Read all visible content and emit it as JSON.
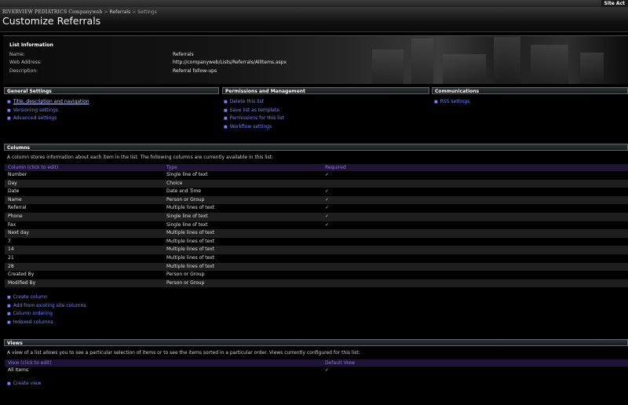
{
  "topbar": {
    "site_actions": "Site Act"
  },
  "breadcrumb": {
    "site": "RIVERVIEW PEDIATRICS Companyweb",
    "list": "Referrals",
    "current": "Settings",
    "sep": ">"
  },
  "page_title": "Customize Referrals",
  "list_info": {
    "heading": "List Information",
    "name_label": "Name:",
    "name_value": "Referrals",
    "web_label": "Web Address:",
    "web_value": "http://companyweb/Lists/Referrals/AllItems.aspx",
    "desc_label": "Description:",
    "desc_value": "Referral follow-ups"
  },
  "general_settings": {
    "title": "General Settings",
    "links": [
      "Title, description and navigation",
      "Versioning settings",
      "Advanced settings"
    ]
  },
  "permissions": {
    "title": "Permissions and Management",
    "links": [
      "Delete this list",
      "Save list as template",
      "Permissions for this list",
      "Workflow settings"
    ]
  },
  "communications": {
    "title": "Communications",
    "links": [
      "RSS settings"
    ]
  },
  "columns": {
    "title": "Columns",
    "description": "A column stores information about each item in the list. The following columns are currently available in this list:",
    "headers": [
      "Column (click to edit)",
      "Type",
      "Required"
    ],
    "check": "✓",
    "rows": [
      {
        "name": "Number",
        "type": "Single line of text",
        "req": "✓"
      },
      {
        "name": "Day",
        "type": "Choice",
        "req": ""
      },
      {
        "name": "Date",
        "type": "Date and Time",
        "req": "✓"
      },
      {
        "name": "Name",
        "type": "Person or Group",
        "req": "✓"
      },
      {
        "name": "Referral",
        "type": "Multiple lines of text",
        "req": "✓"
      },
      {
        "name": "Phone",
        "type": "Single line of text",
        "req": "✓"
      },
      {
        "name": "Fax",
        "type": "Single line of text",
        "req": "✓"
      },
      {
        "name": "Next day",
        "type": "Multiple lines of text",
        "req": ""
      },
      {
        "name": "7",
        "type": "Multiple lines of text",
        "req": ""
      },
      {
        "name": "14",
        "type": "Multiple lines of text",
        "req": ""
      },
      {
        "name": "21",
        "type": "Multiple lines of text",
        "req": ""
      },
      {
        "name": "28",
        "type": "Multiple lines of text",
        "req": ""
      },
      {
        "name": "Created By",
        "type": "Person or Group",
        "req": ""
      },
      {
        "name": "Modified By",
        "type": "Person or Group",
        "req": ""
      }
    ],
    "links": [
      "Create column",
      "Add from existing site columns",
      "Column ordering",
      "Indexed columns"
    ]
  },
  "views": {
    "title": "Views",
    "description": "A view of a list allows you to see a particular selection of items or to see the items sorted in a particular order. Views currently configured for this list:",
    "headers": [
      "View (click to edit)",
      "Default View"
    ],
    "rows": [
      {
        "name": "All Items",
        "default": "✓"
      }
    ],
    "links": [
      "Create view"
    ]
  },
  "colors": {
    "link": "#6f86ff",
    "header_bg": "#201436",
    "header_text": "#8a7bd0"
  }
}
